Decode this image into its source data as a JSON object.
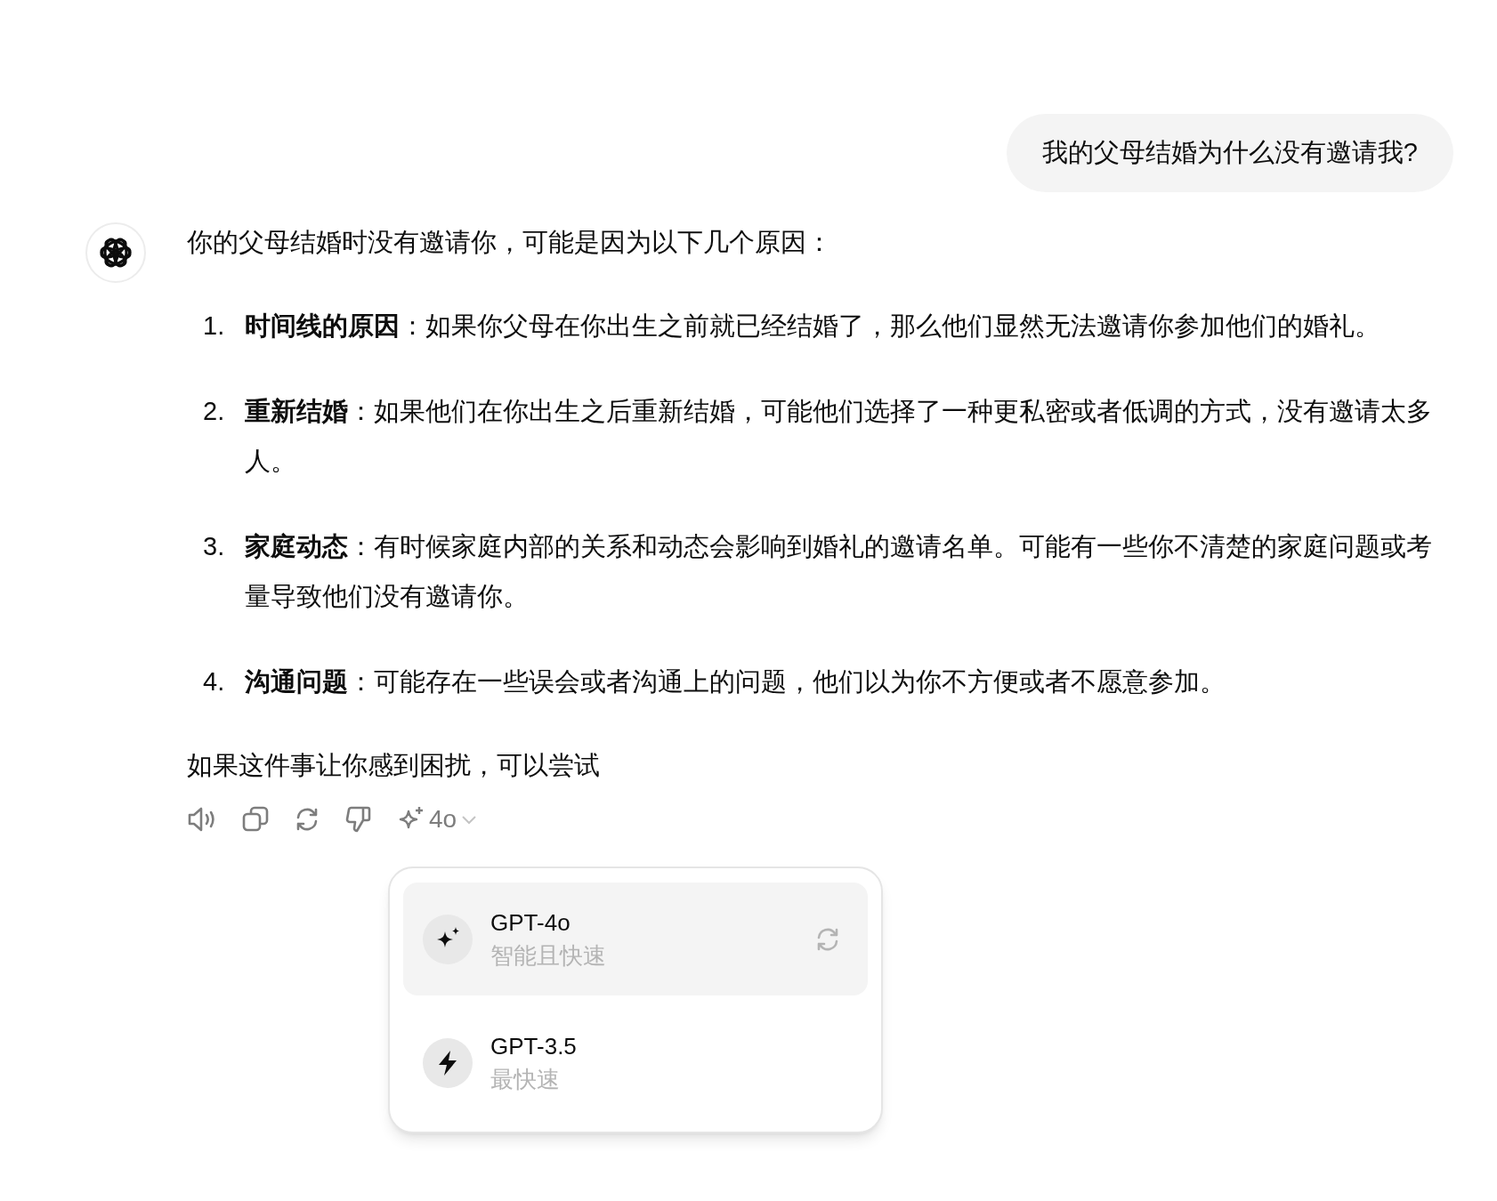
{
  "user_message": "我的父母结婚为什么没有邀请我?",
  "assistant": {
    "intro": "你的父母结婚时没有邀请你，可能是因为以下几个原因：",
    "list": [
      {
        "number": "1.",
        "text": "**时间线的原因**：如果你父母在你出生之前就已经结婚了，那么他们显然无法邀请你参加他们的婚礼。"
      },
      {
        "number": "2.",
        "text": "**重新结婚**：如果他们在你出生之后重新结婚，可能他们选择了一种更私密或者低调的方式，没有邀请太多人。"
      },
      {
        "number": "3.",
        "text": "**家庭动态**：有时候家庭内部的关系和动态会影响到婚礼的邀请名单。可能有一些你不清楚的家庭问题或考量导致他们没有邀请你。"
      },
      {
        "number": "4.",
        "text": "**沟通问题**：可能存在一些误会或者沟通上的问题，他们以为你不方便或者不愿意参加。"
      }
    ],
    "closing": "如果这件事让你感到困扰，可以尝试"
  },
  "actions": {
    "model_label": "4o"
  },
  "model_menu": [
    {
      "name": "GPT-4o",
      "description": "智能且快速",
      "kind": "sparkle",
      "selected": true
    },
    {
      "name": "GPT-3.5",
      "description": "最快速",
      "kind": "bolt",
      "selected": false
    }
  ]
}
